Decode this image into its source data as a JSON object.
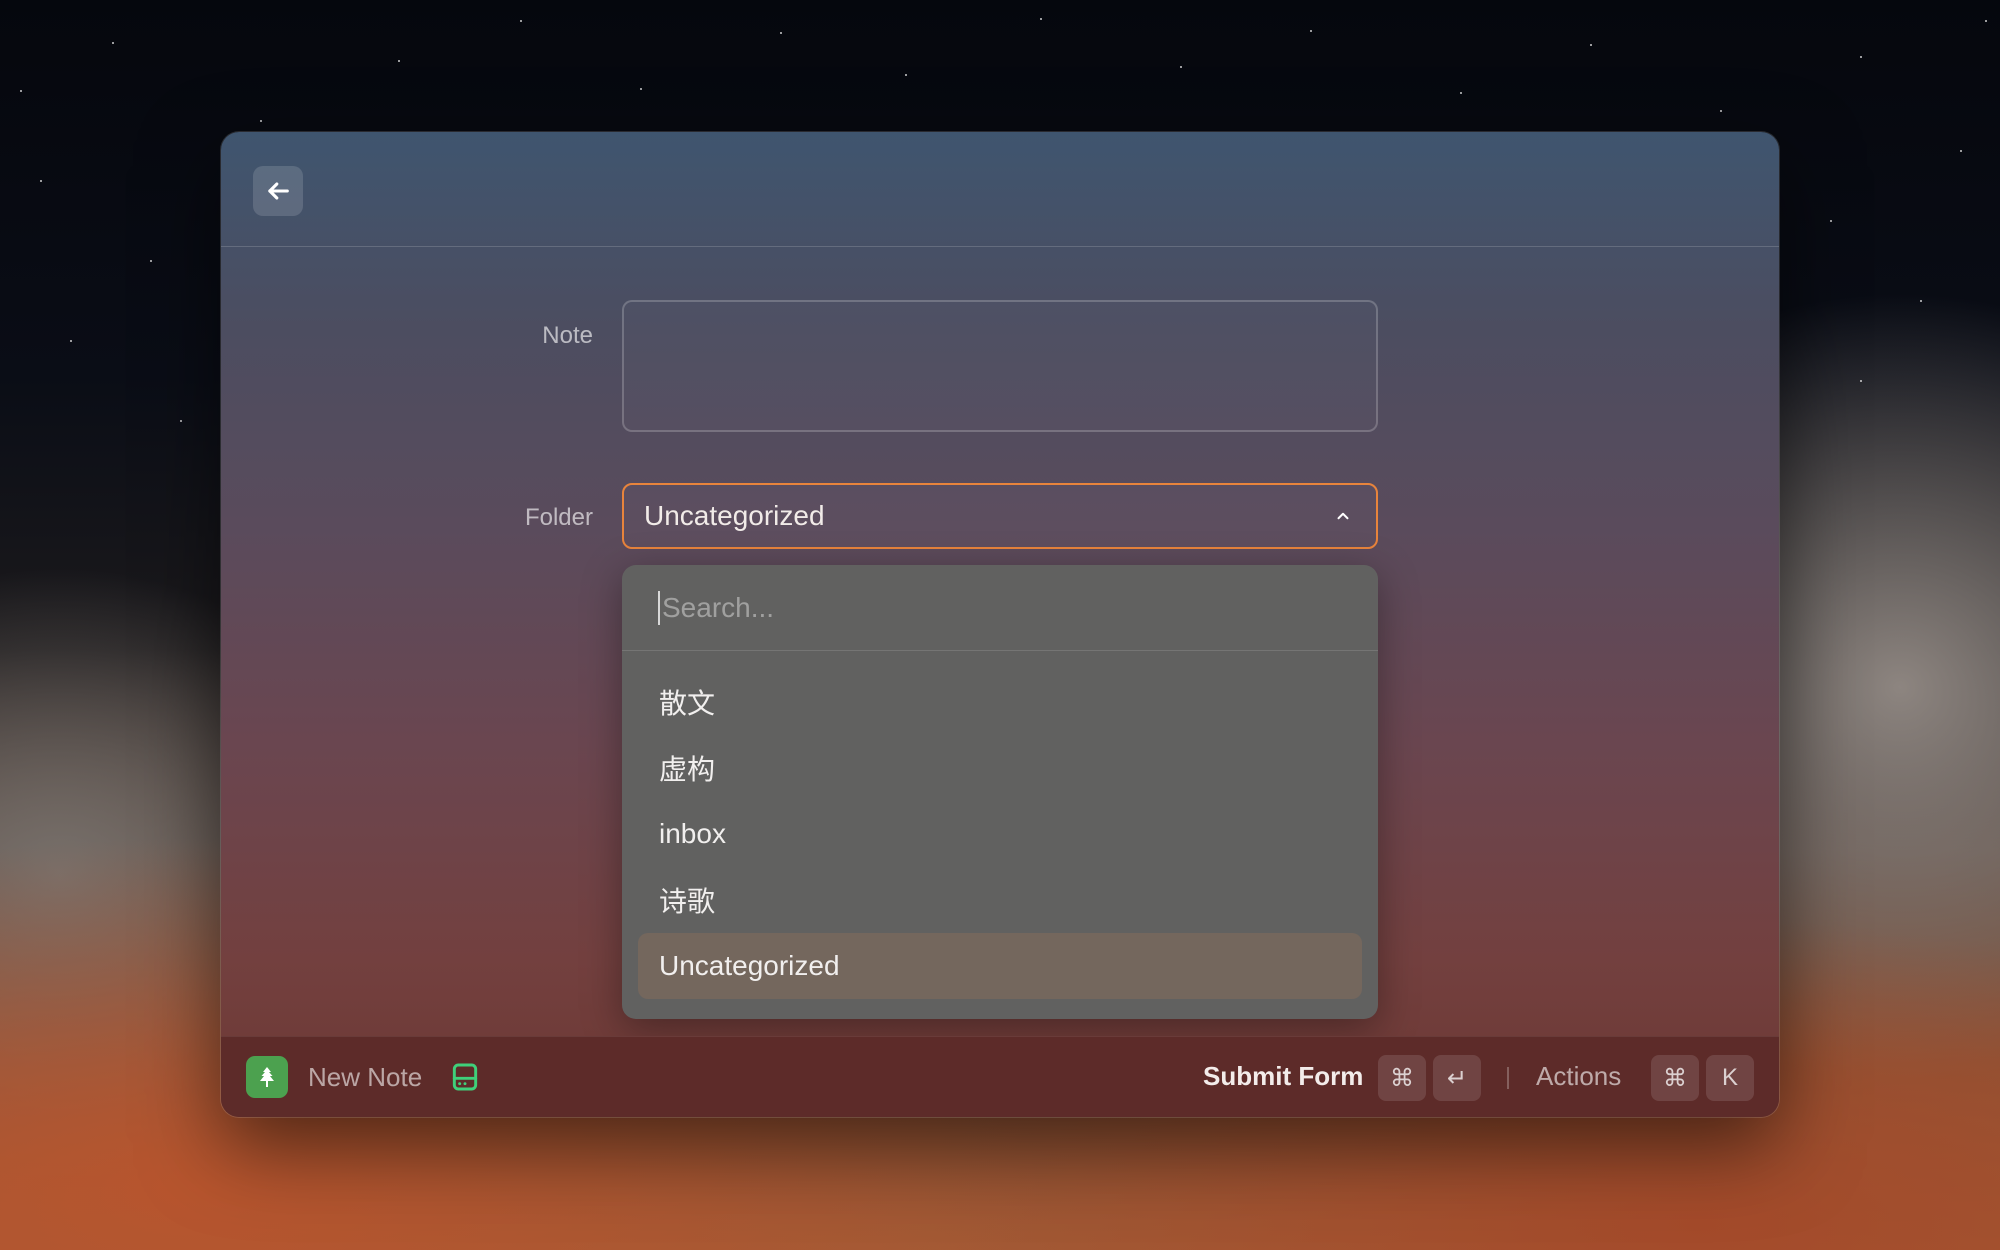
{
  "form": {
    "note_label": "Note",
    "note_value": "",
    "folder_label": "Folder",
    "folder_value": "Uncategorized"
  },
  "dropdown": {
    "search_placeholder": "Search...",
    "items": [
      {
        "label": "散文",
        "selected": false
      },
      {
        "label": "虚构",
        "selected": false
      },
      {
        "label": "inbox",
        "selected": false
      },
      {
        "label": "诗歌",
        "selected": false
      },
      {
        "label": "Uncategorized",
        "selected": true
      }
    ]
  },
  "footer": {
    "app_name": "New Note",
    "submit_label": "Submit Form",
    "submit_keys": [
      "⌘",
      "↵"
    ],
    "actions_label": "Actions",
    "actions_keys": [
      "⌘",
      "K"
    ]
  },
  "colors": {
    "focus_accent": "#e8843c",
    "app_icon_bg": "#4ca14f",
    "drive_icon": "#3fd07a"
  },
  "icons": {
    "back": "arrow-left-icon",
    "chevron": "chevron-up-icon",
    "app": "tree-icon",
    "drive": "hard-drive-icon"
  }
}
